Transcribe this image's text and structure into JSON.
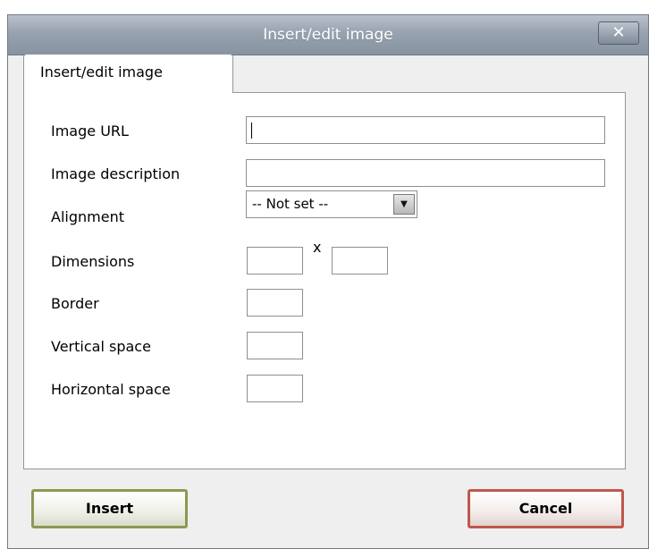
{
  "dialog": {
    "title": "Insert/edit image",
    "close_label": "✕",
    "tab_label": "Insert/edit image"
  },
  "form": {
    "image_url": {
      "label": "Image URL",
      "value": ""
    },
    "image_description": {
      "label": "Image description",
      "value": ""
    },
    "alignment": {
      "label": "Alignment",
      "selected": "-- Not set --"
    },
    "dimensions": {
      "label": "Dimensions",
      "separator": "x",
      "width": "",
      "height": ""
    },
    "border": {
      "label": "Border",
      "value": ""
    },
    "vertical_space": {
      "label": "Vertical space",
      "value": ""
    },
    "horizontal_space": {
      "label": "Horizontal space",
      "value": ""
    }
  },
  "buttons": {
    "insert": "Insert",
    "cancel": "Cancel"
  },
  "colors": {
    "insert_border": "#8a9a52",
    "cancel_border": "#c0574b",
    "titlebar": "#97a2af"
  }
}
